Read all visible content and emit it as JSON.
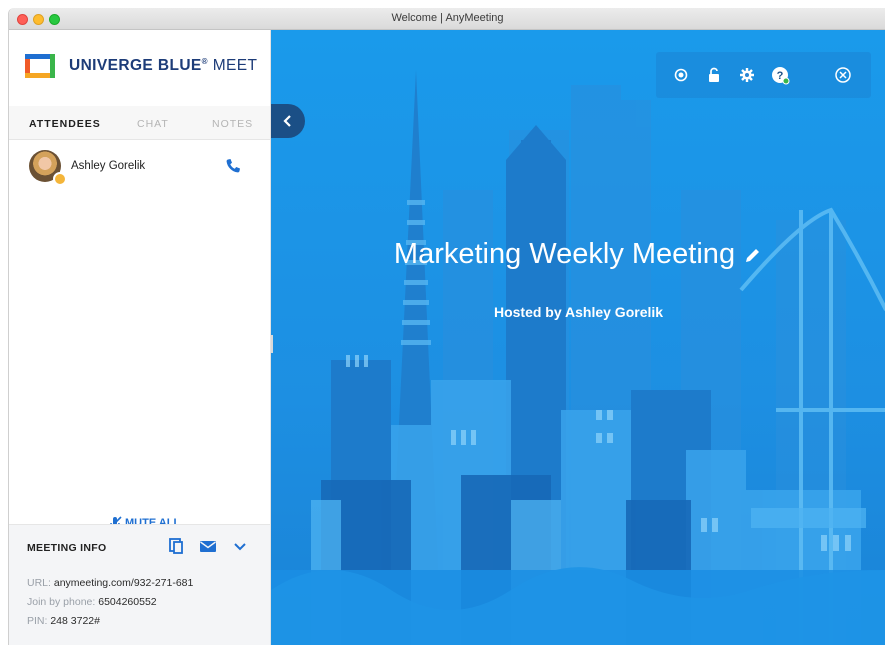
{
  "window": {
    "title": "Welcome | AnyMeeting"
  },
  "brand": {
    "name": "UNIVERGE BLUE",
    "reg": "®",
    "product": "MEET"
  },
  "sidebar": {
    "tabs": [
      {
        "label": "ATTENDEES",
        "active": true
      },
      {
        "label": "CHAT",
        "active": false
      },
      {
        "label": "NOTES",
        "active": false
      }
    ],
    "attendees": [
      {
        "name": "Ashley Gorelik",
        "role_icon": "host-badge-icon",
        "action_icon": "phone-icon"
      }
    ],
    "mute_all_label": "MUTE ALL"
  },
  "meeting_info": {
    "title": "MEETING INFO",
    "url_label": "URL:",
    "url_value": "anymeeting.com/932-271-681",
    "phone_label": "Join by phone:",
    "phone_value": "6504260552",
    "pin_label": "PIN:",
    "pin_value": "248 3722#"
  },
  "stage": {
    "meeting_title": "Marketing Weekly Meeting",
    "hosted_by": "Hosted by Ashley Gorelik",
    "controls": [
      "record-icon",
      "lock-icon",
      "settings-icon",
      "help-icon",
      "close-icon"
    ]
  },
  "colors": {
    "brand_blue": "#1d3c78",
    "accent": "#1f6fd1",
    "stage_bg": "#1a9aeb",
    "collapse_btn": "#1b4f86"
  }
}
